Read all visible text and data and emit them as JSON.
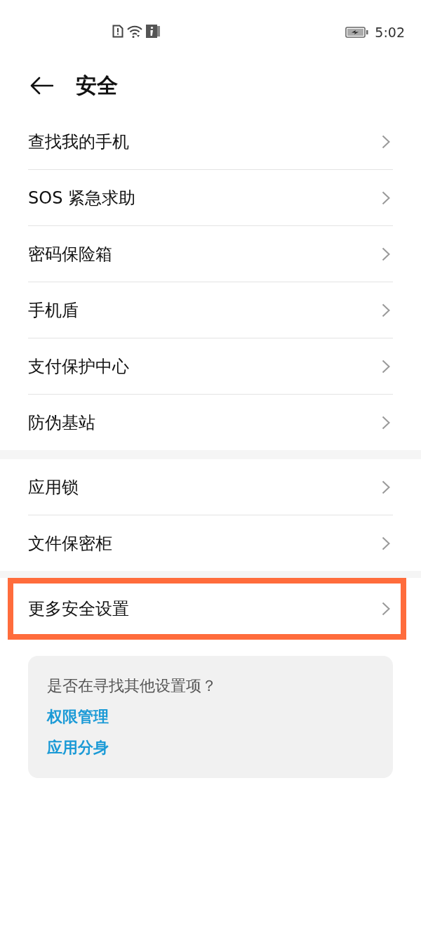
{
  "status_bar": {
    "time": "5:02"
  },
  "header": {
    "title": "安全"
  },
  "groups": [
    {
      "items": [
        {
          "label": "查找我的手机",
          "highlighted": false
        },
        {
          "label": "SOS 紧急求助",
          "highlighted": false
        },
        {
          "label": "密码保险箱",
          "highlighted": false
        },
        {
          "label": "手机盾",
          "highlighted": false
        },
        {
          "label": "支付保护中心",
          "highlighted": false
        },
        {
          "label": "防伪基站",
          "highlighted": false
        }
      ]
    },
    {
      "items": [
        {
          "label": "应用锁",
          "highlighted": false
        },
        {
          "label": "文件保密柜",
          "highlighted": false
        }
      ]
    },
    {
      "items": [
        {
          "label": "更多安全设置",
          "highlighted": true
        }
      ]
    }
  ],
  "suggestion_card": {
    "prompt": "是否在寻找其他设置项？",
    "links": [
      "权限管理",
      "应用分身"
    ]
  }
}
